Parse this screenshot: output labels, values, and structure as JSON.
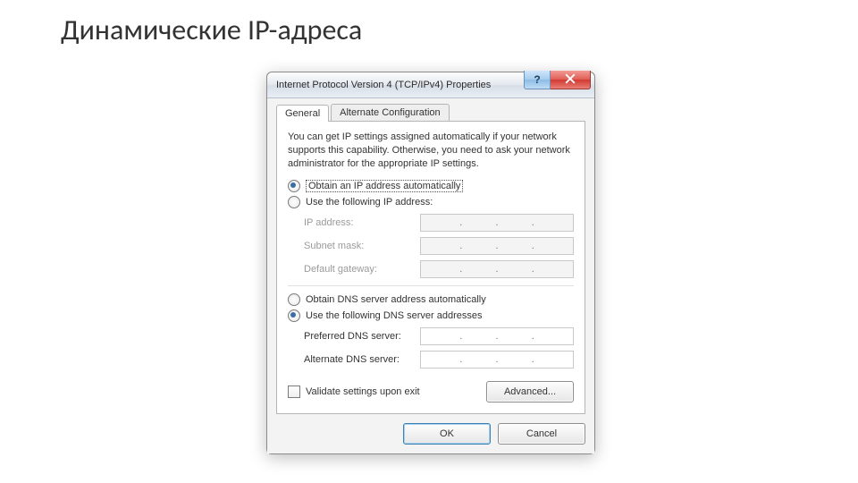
{
  "slide": {
    "title": "Динамические IP-адреса"
  },
  "dialog": {
    "title": "Internet Protocol Version 4 (TCP/IPv4) Properties",
    "tabs": {
      "general": "General",
      "alternate": "Alternate Configuration"
    },
    "description": "You can get IP settings assigned automatically if your network supports this capability. Otherwise, you need to ask your network administrator for the appropriate IP settings.",
    "ip": {
      "auto_label": "Obtain an IP address automatically",
      "manual_label": "Use the following IP address:",
      "selected": "auto",
      "fields": {
        "ip_address": {
          "label": "IP address:",
          "value": ""
        },
        "subnet_mask": {
          "label": "Subnet mask:",
          "value": ""
        },
        "default_gateway": {
          "label": "Default gateway:",
          "value": ""
        }
      }
    },
    "dns": {
      "auto_label": "Obtain DNS server address automatically",
      "manual_label": "Use the following DNS server addresses",
      "selected": "manual",
      "fields": {
        "preferred": {
          "label": "Preferred DNS server:",
          "value": ""
        },
        "alternate": {
          "label": "Alternate DNS server:",
          "value": ""
        }
      }
    },
    "validate_label": "Validate settings upon exit",
    "validate_checked": false,
    "buttons": {
      "advanced": "Advanced...",
      "ok": "OK",
      "cancel": "Cancel",
      "help": "?",
      "close": "Close"
    }
  }
}
